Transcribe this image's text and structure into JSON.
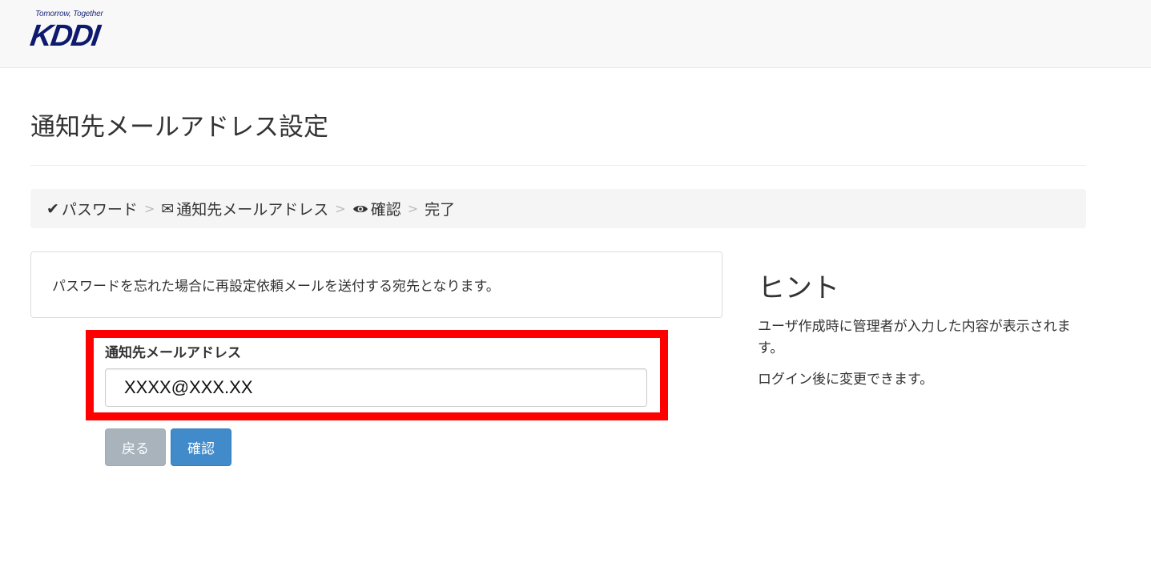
{
  "header": {
    "logo_tagline": "Tomorrow, Together",
    "logo_text": "KDDI",
    "brand_color": "#0d1a6e"
  },
  "page": {
    "title": "通知先メールアドレス設定"
  },
  "breadcrumb": {
    "steps": [
      {
        "label": "パスワード",
        "icon": "check-icon",
        "glyph": "✔"
      },
      {
        "label": "通知先メールアドレス",
        "icon": "envelope-icon",
        "glyph": "✉"
      },
      {
        "label": "確認",
        "icon": "eye-icon",
        "glyph": "👁"
      },
      {
        "label": "完了",
        "icon": "",
        "glyph": ""
      }
    ],
    "separator": ">"
  },
  "info": {
    "text": "パスワードを忘れた場合に再設定依頼メールを送付する宛先となります。"
  },
  "form": {
    "email_label": "通知先メールアドレス",
    "email_value": "XXXX@XXX.XX",
    "highlight_color": "#ff0000"
  },
  "buttons": {
    "back_label": "戻る",
    "confirm_label": "確認",
    "back_color": "#a9b3bc",
    "confirm_color": "#428bca"
  },
  "hint": {
    "title": "ヒント",
    "text1": "ユーザ作成時に管理者が入力した内容が表示されます。",
    "text2": "ログイン後に変更できます。"
  }
}
